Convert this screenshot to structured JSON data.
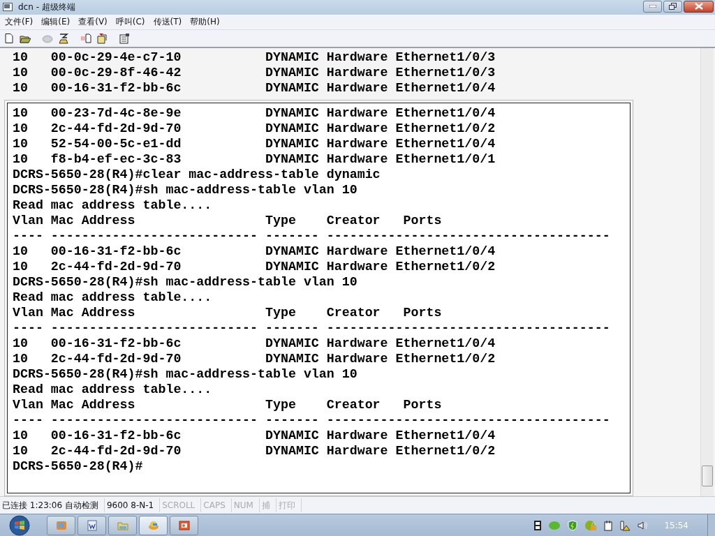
{
  "window": {
    "title": "dcn - 超级终端"
  },
  "menu": [
    "文件(F)",
    "编辑(E)",
    "查看(V)",
    "呼叫(C)",
    "传送(T)",
    "帮助(H)"
  ],
  "toolbar": [
    {
      "kind": "new",
      "disabled": false
    },
    {
      "kind": "open",
      "disabled": false
    },
    {
      "kind": "call",
      "disabled": true
    },
    {
      "kind": "hangup",
      "disabled": false
    },
    {
      "kind": "send",
      "disabled": false
    },
    {
      "kind": "receive",
      "disabled": false
    },
    {
      "kind": "properties",
      "disabled": false
    }
  ],
  "terminal": {
    "scrolled_lines": [
      "10   00-0c-29-4e-c7-10           DYNAMIC Hardware Ethernet1/0/3",
      "10   00-0c-29-8f-46-42           DYNAMIC Hardware Ethernet1/0/3",
      "10   00-16-31-f2-bb-6c           DYNAMIC Hardware Ethernet1/0/4"
    ],
    "lines": [
      "10   00-23-7d-4c-8e-9e           DYNAMIC Hardware Ethernet1/0/4",
      "10   2c-44-fd-2d-9d-70           DYNAMIC Hardware Ethernet1/0/2",
      "10   52-54-00-5c-e1-dd           DYNAMIC Hardware Ethernet1/0/4",
      "10   f8-b4-ef-ec-3c-83           DYNAMIC Hardware Ethernet1/0/1",
      "DCRS-5650-28(R4)#clear mac-address-table dynamic",
      "DCRS-5650-28(R4)#sh mac-address-table vlan 10",
      "Read mac address table....",
      "Vlan Mac Address                 Type    Creator   Ports",
      "---- --------------------------- ------- -------------------------------------",
      "10   00-16-31-f2-bb-6c           DYNAMIC Hardware Ethernet1/0/4",
      "10   2c-44-fd-2d-9d-70           DYNAMIC Hardware Ethernet1/0/2",
      "DCRS-5650-28(R4)#sh mac-address-table vlan 10",
      "Read mac address table....",
      "Vlan Mac Address                 Type    Creator   Ports",
      "---- --------------------------- ------- -------------------------------------",
      "10   00-16-31-f2-bb-6c           DYNAMIC Hardware Ethernet1/0/4",
      "10   2c-44-fd-2d-9d-70           DYNAMIC Hardware Ethernet1/0/2",
      "DCRS-5650-28(R4)#sh mac-address-table vlan 10",
      "Read mac address table....",
      "Vlan Mac Address                 Type    Creator   Ports",
      "---- --------------------------- ------- -------------------------------------",
      "10   00-16-31-f2-bb-6c           DYNAMIC Hardware Ethernet1/0/4",
      "10   2c-44-fd-2d-9d-70           DYNAMIC Hardware Ethernet1/0/2",
      "DCRS-5650-28(R4)#"
    ]
  },
  "status_bar": [
    {
      "text": "已连接 1:23:06 自动检测",
      "disabled": false
    },
    {
      "text": "9600 8-N-1",
      "disabled": false
    },
    {
      "text": "SCROLL",
      "disabled": true
    },
    {
      "text": "CAPS",
      "disabled": true
    },
    {
      "text": "NUM",
      "disabled": true
    },
    {
      "text": "捕",
      "disabled": true
    },
    {
      "text": "打印",
      "disabled": true
    }
  ],
  "taskbar": {
    "buttons": [
      {
        "kind": "explorer",
        "selected": false
      },
      {
        "kind": "word",
        "selected": false
      },
      {
        "kind": "folder",
        "selected": false
      },
      {
        "kind": "terminal",
        "selected": true
      },
      {
        "kind": "slides",
        "selected": false
      }
    ],
    "tray": [
      {
        "kind": "film"
      },
      {
        "kind": "app"
      },
      {
        "kind": "shield"
      },
      {
        "kind": "lock"
      },
      {
        "kind": "plug"
      },
      {
        "kind": "network"
      },
      {
        "kind": "volume"
      }
    ],
    "clock": "15:54"
  }
}
